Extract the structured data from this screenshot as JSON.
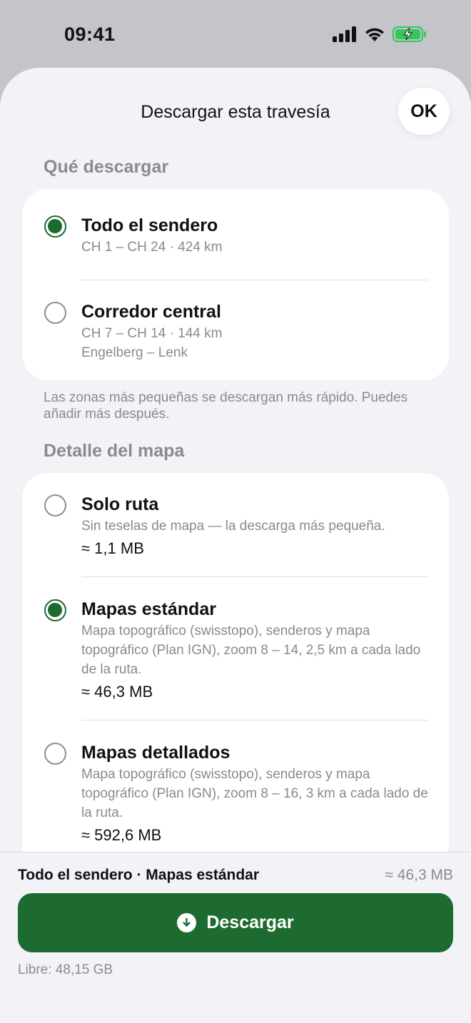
{
  "status": {
    "time": "09:41"
  },
  "header": {
    "title": "Descargar esta travesía",
    "ok_label": "OK"
  },
  "what_section": {
    "label": "Qué descargar",
    "options": [
      {
        "title": "Todo el sendero",
        "subtitle": "CH 1 – CH 24 · 424 km",
        "selected": true
      },
      {
        "title": "Corredor central",
        "subtitle": "CH 7 – CH 14 · 144 km",
        "subtitle2": "Engelberg – Lenk",
        "selected": false
      }
    ],
    "footnote": "Las zonas más pequeñas se descargan más rápido. Puedes añadir más después."
  },
  "detail_section": {
    "label": "Detalle del mapa",
    "options": [
      {
        "title": "Solo ruta",
        "description": "Sin teselas de mapa — la descarga más pequeña.",
        "size": "≈ 1,1 MB",
        "selected": false
      },
      {
        "title": "Mapas estándar",
        "description": "Mapa topográfico (swisstopo), senderos y mapa topográfico (Plan IGN), zoom 8 – 14, 2,5 km a cada lado de la ruta.",
        "size": "≈ 46,3 MB",
        "selected": true
      },
      {
        "title": "Mapas detallados",
        "description": "Mapa topográfico (swisstopo), senderos y mapa topográfico (Plan IGN), zoom 8 – 16, 3 km a cada lado de la ruta.",
        "size": "≈ 592,6 MB",
        "selected": false
      }
    ]
  },
  "footer": {
    "summary": "Todo el sendero · Mapas estándar",
    "summary_size": "≈ 46,3 MB",
    "download_label": "Descargar",
    "free_space": "Libre: 48,15 GB"
  },
  "colors": {
    "accent": "#1e6b31",
    "battery": "#34c759"
  }
}
